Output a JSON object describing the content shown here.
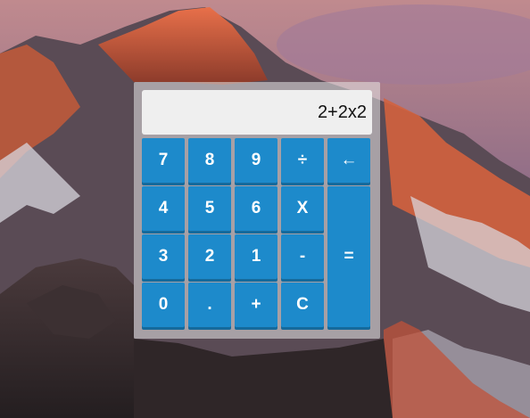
{
  "calculator": {
    "display_value": "2+2x2",
    "keys": {
      "seven": "7",
      "eight": "8",
      "nine": "9",
      "divide": "÷",
      "backspace": "←",
      "four": "4",
      "five": "5",
      "six": "6",
      "multiply": "X",
      "three": "3",
      "two": "2",
      "one": "1",
      "subtract": "-",
      "equals": "=",
      "zero": "0",
      "decimal": ".",
      "add": "+",
      "clear": "C"
    }
  },
  "colors": {
    "key_background": "#1d8acb",
    "key_text": "#ffffff",
    "display_background": "#efefef"
  }
}
